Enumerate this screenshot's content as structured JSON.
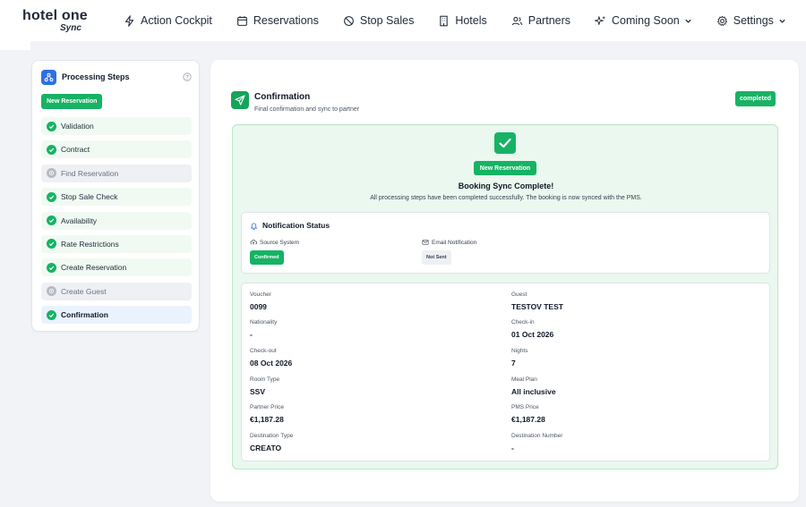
{
  "logo": {
    "main": "hotel one",
    "sub": "Sync"
  },
  "nav": [
    {
      "label": "Action Cockpit",
      "icon": "lightning-icon"
    },
    {
      "label": "Reservations",
      "icon": "calendar-icon"
    },
    {
      "label": "Stop Sales",
      "icon": "prohibited-icon"
    },
    {
      "label": "Hotels",
      "icon": "building-icon"
    },
    {
      "label": "Partners",
      "icon": "users-icon"
    },
    {
      "label": "Coming Soon",
      "icon": "sparkles-icon",
      "dropdown": true
    },
    {
      "label": "Settings",
      "icon": "gear-icon",
      "dropdown": true
    }
  ],
  "sidebar": {
    "title": "Processing Steps",
    "badge": "New Reservation",
    "steps": [
      {
        "label": "Validation",
        "state": "done"
      },
      {
        "label": "Contract",
        "state": "done"
      },
      {
        "label": "Find Reservation",
        "state": "pending"
      },
      {
        "label": "Stop Sale Check",
        "state": "done"
      },
      {
        "label": "Availability",
        "state": "done"
      },
      {
        "label": "Rate Restrictions",
        "state": "done"
      },
      {
        "label": "Create Reservation",
        "state": "done"
      },
      {
        "label": "Create Guest",
        "state": "pending"
      },
      {
        "label": "Confirmation",
        "state": "active"
      }
    ]
  },
  "main": {
    "title": "Confirmation",
    "subtitle": "Final confirmation and sync to partner",
    "status": "completed",
    "success": {
      "badge": "New Reservation",
      "title": "Booking Sync Complete!",
      "description": "All processing steps have been completed successfully. The booking is now synced with the PMS."
    },
    "notification": {
      "title": "Notification Status",
      "source_label": "Source System",
      "source_value": "Confirmed",
      "email_label": "Email Notification",
      "email_value": "Not Sent"
    },
    "details": {
      "voucher_label": "Voucher",
      "voucher": "0099",
      "guest_label": "Guest",
      "guest": "TESTOV TEST",
      "nationality_label": "Nationality",
      "nationality": "-",
      "checkin_label": "Check-in",
      "checkin": "01 Oct 2026",
      "checkout_label": "Check-out",
      "checkout": "08 Oct 2026",
      "nights_label": "Nights",
      "nights": "7",
      "room_label": "Room Type",
      "room": "SSV",
      "meal_label": "Meal Plan",
      "meal": "All inclusive",
      "partner_price_label": "Partner Price",
      "partner_price": "€1,187.28",
      "pms_price_label": "PMS Price",
      "pms_price": "€1,187.28",
      "dest_type_label": "Destination Type",
      "dest_type": "CREATO",
      "dest_number_label": "Destination Number",
      "dest_number": "-"
    }
  },
  "colors": {
    "accent_green": "#16b364",
    "brand_blue": "#2f6fe4"
  }
}
